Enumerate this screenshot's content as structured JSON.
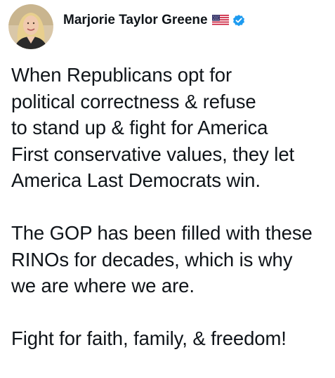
{
  "tweet": {
    "author": {
      "display_name": "Marjorie Taylor Greene",
      "flag_icon": "us-flag-icon",
      "verified_icon": "verified-badge-icon",
      "verified_color": "#1d9bf0"
    },
    "paragraphs": [
      {
        "lines": [
          "When Republicans opt for",
          "political correctness & refuse",
          "to stand up & fight for America",
          "First conservative values, they let",
          "America Last Democrats win."
        ]
      },
      {
        "lines": [
          "The GOP has been filled with these",
          "RINOs for decades, which is why",
          "we are where we are."
        ]
      },
      {
        "lines": [
          "Fight for faith, family, & freedom!"
        ]
      }
    ]
  }
}
